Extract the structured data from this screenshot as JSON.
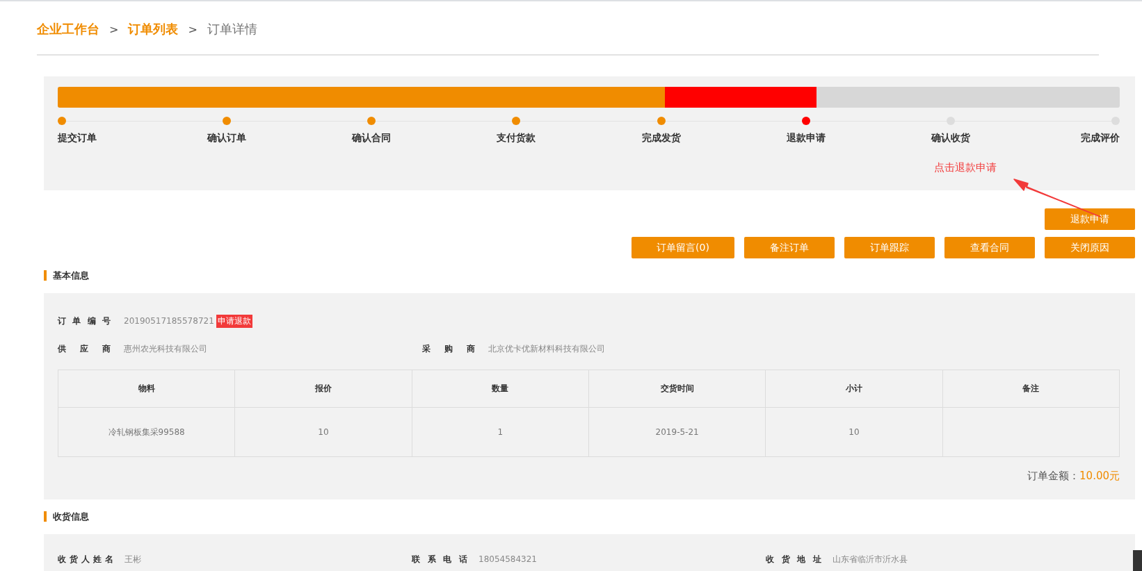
{
  "breadcrumb": [
    {
      "label": "企业工作台",
      "kind": "link"
    },
    {
      "label": ">",
      "kind": "sep"
    },
    {
      "label": "订单列表",
      "kind": "link"
    },
    {
      "label": ">",
      "kind": "sep"
    },
    {
      "label": "订单详情",
      "kind": "current"
    }
  ],
  "steps": [
    {
      "label": "提交订单",
      "done": true,
      "current": false
    },
    {
      "label": "确认订单",
      "done": true,
      "current": false
    },
    {
      "label": "确认合同",
      "done": true,
      "current": false
    },
    {
      "label": "支付货款",
      "done": true,
      "current": false
    },
    {
      "label": "完成发货",
      "done": true,
      "current": false
    },
    {
      "label": "退款申请",
      "done": false,
      "current": true
    },
    {
      "label": "确认收货",
      "done": false,
      "current": false
    },
    {
      "label": "完成评价",
      "done": false,
      "current": false
    }
  ],
  "annotation": "点击退款申请",
  "refund_button": "退款申请",
  "action_buttons": [
    "订单留言(0)",
    "备注订单",
    "订单跟踪",
    "查看合同",
    "关闭原因"
  ],
  "basic_info": {
    "title": "基本信息",
    "order_no": {
      "label": "订单编号",
      "value": "20190517185578721",
      "tag": "申请退款"
    },
    "supplier": {
      "label": "供应商",
      "value": "惠州农光科技有限公司"
    },
    "buyer": {
      "label": "采购商",
      "value": "北京优卡优新材料科技有限公司"
    },
    "table": {
      "columns": [
        "物料",
        "报价",
        "数量",
        "交货时间",
        "小计",
        "备注"
      ],
      "rows": [
        [
          "冷轧钢板集采99588",
          "10",
          "1",
          "2019-5-21",
          "10",
          ""
        ]
      ]
    },
    "total_label": "订单金额：",
    "total_value": "10.00元"
  },
  "shipping_info": {
    "title": "收货信息",
    "fields": [
      {
        "label": "收货人姓名",
        "value": "王彬"
      },
      {
        "label": "联系电话",
        "value": "18054584321"
      },
      {
        "label": "收货地址",
        "value": "山东省临沂市沂水县"
      }
    ]
  }
}
